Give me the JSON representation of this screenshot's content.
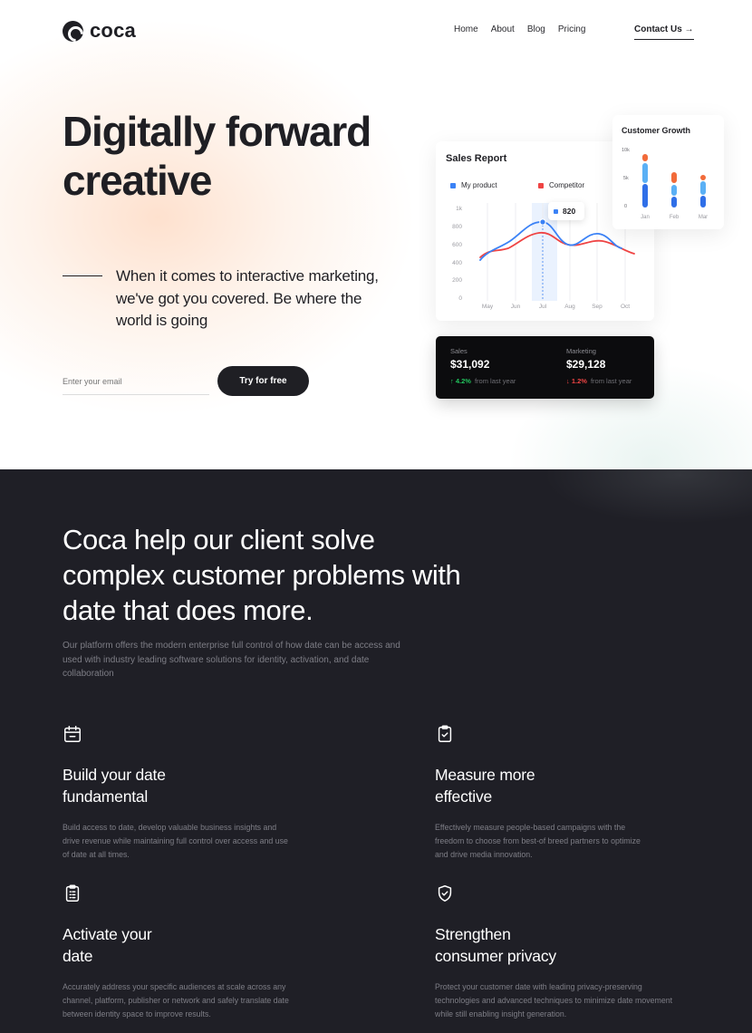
{
  "brand": {
    "name": "coca"
  },
  "nav": {
    "items": [
      "Home",
      "About",
      "Blog",
      "Pricing"
    ],
    "contact_label": "Contact Us →"
  },
  "hero": {
    "title": "Digitally forward creative",
    "tagline": "When it comes to interactive marketing, we've got you covered. Be where the world is going",
    "email_placeholder": "Enter your email",
    "cta_label": "Try for free"
  },
  "sales_report": {
    "title": "Sales Report",
    "legend": [
      "My product",
      "Competitor"
    ],
    "tooltip_value": "820",
    "y_ticks": [
      "1k",
      "800",
      "600",
      "400",
      "200",
      "0"
    ],
    "x_ticks": [
      "May",
      "Jun",
      "Jul",
      "Aug",
      "Sep",
      "Oct"
    ]
  },
  "customer_growth": {
    "title": "Customer Growth",
    "y_ticks": [
      "10k",
      "5k",
      "0"
    ],
    "x_ticks": [
      "Jan",
      "Feb",
      "Mar"
    ]
  },
  "stats": {
    "sales": {
      "label": "Sales",
      "value": "$31,092",
      "change": "↑ 4.2%",
      "note": "from last year"
    },
    "marketing": {
      "label": "Marketing",
      "value": "$29,128",
      "change": "↓ 1.2%",
      "note": "from last year"
    }
  },
  "section": {
    "title": "Coca help our client solve complex customer problems with date that does more.",
    "description": "Our platform offers the modern enterprise full control of how date can be access and used with industry leading software solutions for identity, activation, and date collaboration"
  },
  "features": [
    {
      "icon": "calendar-icon",
      "title": "Build your date fundamental",
      "description": "Build access to date, develop valuable business insights and drive revenue while maintaining full control over access and use of date at all times."
    },
    {
      "icon": "clipboard-check-icon",
      "title": "Measure more effective",
      "description": "Effectively measure people-based campaigns with the freedom to choose from best-of breed partners to optimize and drive media innovation."
    },
    {
      "icon": "clipboard-list-icon",
      "title": "Activate your date",
      "description": "Accurately address your specific audiences at scale across any channel, platform, publisher or network and safely translate date between identity space to improve results."
    },
    {
      "icon": "shield-check-icon",
      "title": "Strengthen consumer privacy",
      "description": "Protect your customer date with leading privacy-preserving technologies and advanced techniques to minimize date movement while still enabling insight generation."
    }
  ],
  "colors": {
    "dark_bg": "#1f1f26",
    "text_dark": "#1f1f24",
    "series_my_product": "#3b82f6",
    "series_competitor": "#ef4444",
    "bar_orange": "#f26b3a"
  }
}
